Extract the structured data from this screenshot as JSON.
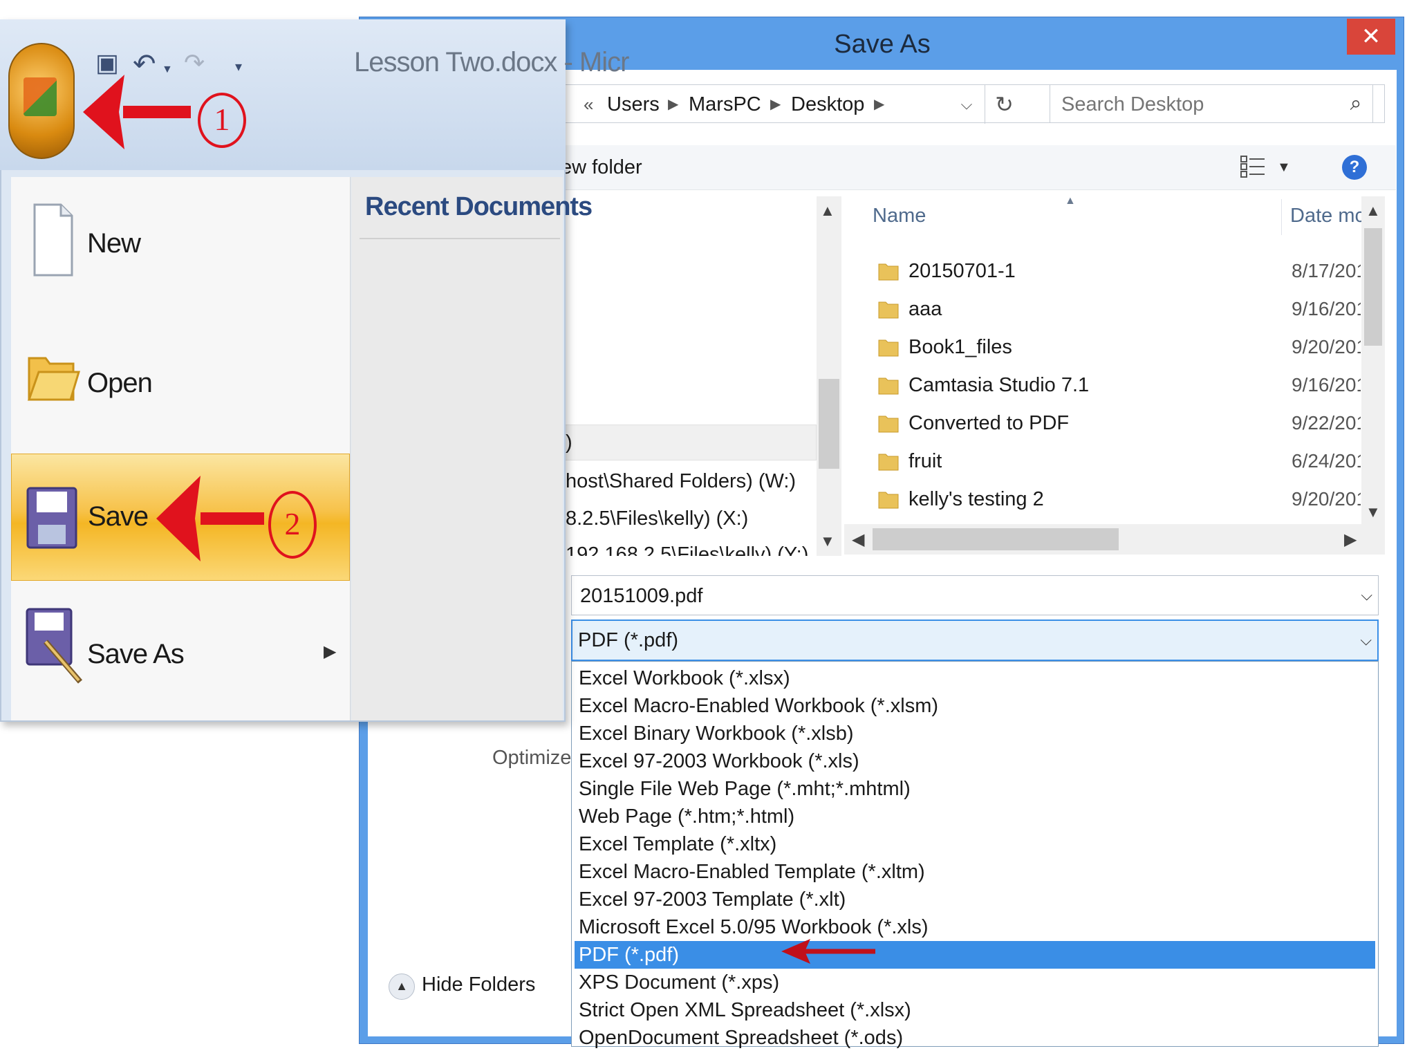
{
  "dialog": {
    "title": "Save As",
    "close_symbol": "✕",
    "breadcrumb": [
      "Users",
      "MarsPC",
      "Desktop"
    ],
    "breadcrumb_prefix": "«",
    "search_placeholder": "Search Desktop",
    "new_folder_label": "ew folder",
    "nav_items": [
      ")",
      "host\\Shared Folders) (W:)",
      "8.2.5\\Files\\kelly) (X:)",
      "192.168.2.5\\Files\\kelly) (Y:)"
    ],
    "columns": {
      "name": "Name",
      "date": "Date mc"
    },
    "files": [
      {
        "name": "20150701-1",
        "date": "8/17/201"
      },
      {
        "name": "aaa",
        "date": "9/16/201"
      },
      {
        "name": "Book1_files",
        "date": "9/20/201"
      },
      {
        "name": "Camtasia Studio 7.1",
        "date": "9/16/201"
      },
      {
        "name": "Converted to PDF",
        "date": "9/22/201"
      },
      {
        "name": "fruit",
        "date": "6/24/201"
      },
      {
        "name": "kelly's testing 2",
        "date": "9/20/201"
      }
    ],
    "file_name_value": "20151009.pdf",
    "save_type_value": "PDF (*.pdf)",
    "save_type_options": [
      "Excel Workbook (*.xlsx)",
      "Excel Macro-Enabled Workbook (*.xlsm)",
      "Excel Binary Workbook (*.xlsb)",
      "Excel 97-2003 Workbook (*.xls)",
      "Single File Web Page (*.mht;*.mhtml)",
      "Web Page (*.htm;*.html)",
      "Excel Template (*.xltx)",
      "Excel Macro-Enabled Template (*.xltm)",
      "Excel 97-2003 Template (*.xlt)",
      "Microsoft Excel 5.0/95 Workbook (*.xls)",
      "PDF (*.pdf)",
      "XPS Document (*.xps)",
      "Strict Open XML Spreadsheet (*.xlsx)",
      "OpenDocument Spreadsheet (*.ods)"
    ],
    "selected_option_index": 10,
    "optimize_label": "Optimize",
    "hide_folders_label": "Hide Folders"
  },
  "office": {
    "document_title": "Lesson Two.docx - Micr",
    "recent_documents_label": "Recent Documents",
    "menu_items": [
      "New",
      "Open",
      "Save",
      "Save As"
    ]
  },
  "annotations": {
    "step1": "1",
    "step2": "2"
  },
  "colors": {
    "arrow_red": "#e0121d",
    "dialog_chrome": "#5b9ee8",
    "selection_blue": "#3a8ee6",
    "save_highlight": "#f7c24a"
  }
}
